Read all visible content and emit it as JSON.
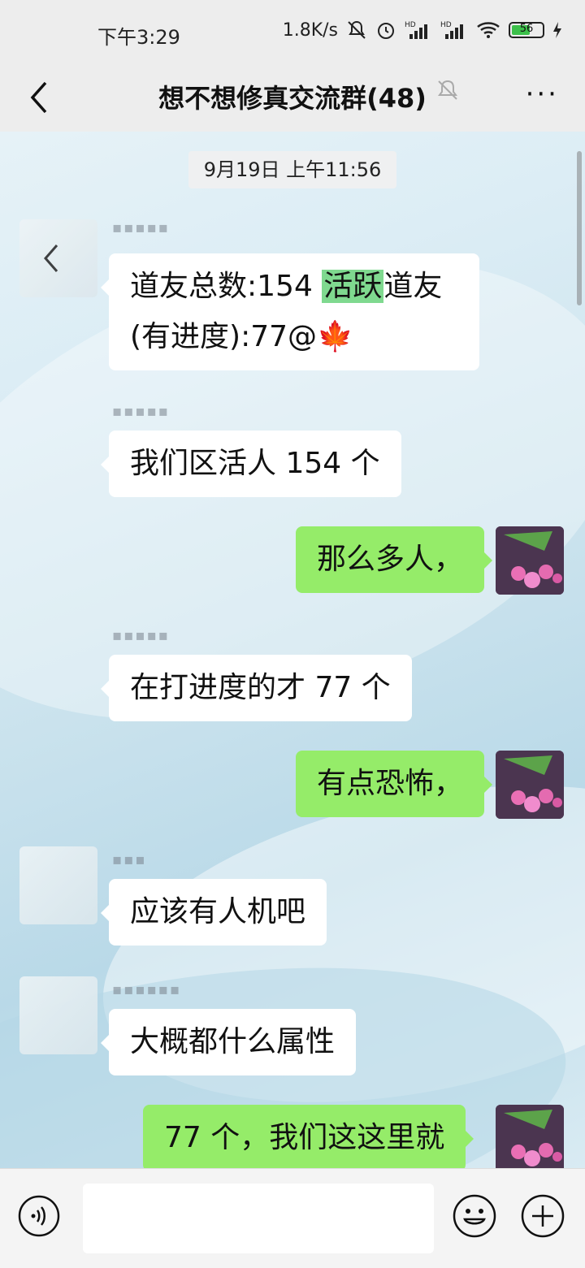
{
  "status_bar": {
    "time": "下午3:29",
    "speed": "1.8K/s",
    "battery": "56",
    "icons": [
      "mute-icon",
      "alarm-icon",
      "hd-signal-icon",
      "hd-signal-icon",
      "wifi-icon",
      "battery-icon",
      "charging-icon"
    ]
  },
  "nav": {
    "title": "想不想修真交流群(48)",
    "back_icon": "chevron-left-icon",
    "muted_icon": "bell-off-icon",
    "more_icon": "more-dots-icon",
    "more_label": "···"
  },
  "chat": {
    "timestamp": "9月19日 上午11:56",
    "messages": [
      {
        "side": "left",
        "line1_pre": "道友总数:154 ",
        "highlight": "活跃",
        "line1_post": "道友",
        "line2": "(有进度):77@🍁"
      },
      {
        "side": "left",
        "text": "我们区活人 154 个"
      },
      {
        "side": "right",
        "text": "那么多人，"
      },
      {
        "side": "left",
        "text": "在打进度的才 77 个"
      },
      {
        "side": "right",
        "text": "有点恐怖，"
      },
      {
        "side": "left",
        "text": "应该有人机吧"
      },
      {
        "side": "left",
        "text": "大概都什么属性"
      },
      {
        "side": "right",
        "text": "77 个，我们这这里就"
      }
    ]
  },
  "input_bar": {
    "voice_icon": "voice-icon",
    "emoji_icon": "emoji-icon",
    "plus_icon": "plus-icon"
  }
}
